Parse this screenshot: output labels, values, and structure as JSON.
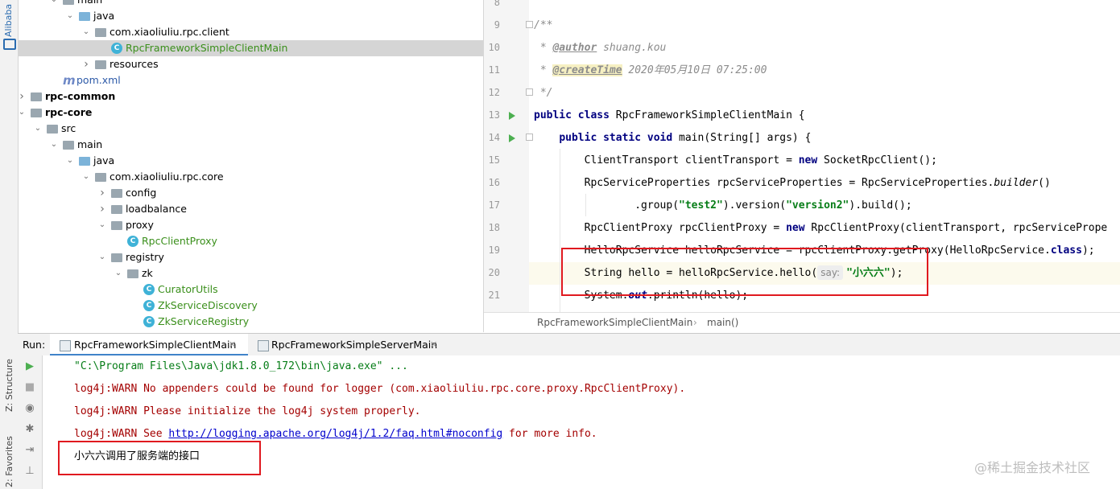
{
  "sidebar": {
    "alibaba_label": "Alibaba",
    "structure_label": "Z: Structure",
    "favorites_label": "2: Favorites"
  },
  "project_tree": {
    "items": [
      {
        "label": "main",
        "type": "folder",
        "expanded": true
      },
      {
        "label": "java",
        "type": "java-folder",
        "expanded": true
      },
      {
        "label": "com.xiaoliuliu.rpc.client",
        "type": "package",
        "expanded": true
      },
      {
        "label": "RpcFrameworkSimpleClientMain",
        "type": "class",
        "selected": true
      },
      {
        "label": "resources",
        "type": "resources-folder",
        "expanded": false
      },
      {
        "label": "pom.xml",
        "type": "maven"
      },
      {
        "label": "rpc-common",
        "type": "module",
        "expanded": false
      },
      {
        "label": "rpc-core",
        "type": "module",
        "expanded": true
      },
      {
        "label": "src",
        "type": "folder",
        "expanded": true
      },
      {
        "label": "main",
        "type": "folder",
        "expanded": true
      },
      {
        "label": "java",
        "type": "java-folder",
        "expanded": true
      },
      {
        "label": "com.xiaoliuliu.rpc.core",
        "type": "package",
        "expanded": true
      },
      {
        "label": "config",
        "type": "package",
        "expanded": false
      },
      {
        "label": "loadbalance",
        "type": "package",
        "expanded": false
      },
      {
        "label": "proxy",
        "type": "package",
        "expanded": true
      },
      {
        "label": "RpcClientProxy",
        "type": "class"
      },
      {
        "label": "registry",
        "type": "package",
        "expanded": true
      },
      {
        "label": "zk",
        "type": "package",
        "expanded": true
      },
      {
        "label": "CuratorUtils",
        "type": "class"
      },
      {
        "label": "ZkServiceDiscovery",
        "type": "class"
      },
      {
        "label": "ZkServiceRegistry",
        "type": "class"
      }
    ]
  },
  "editor": {
    "line_numbers": [
      "8",
      "9",
      "10",
      "11",
      "12",
      "13",
      "14",
      "15",
      "16",
      "17",
      "18",
      "19",
      "20",
      "21"
    ],
    "author_tag": "@author",
    "author_name": " shuang.kou",
    "createtime_tag": "@createTime",
    "createtime_value": " 2020年05月10日 07:25:00",
    "class_decl_name": "RpcFrameworkSimpleClientMain {",
    "main_sig": " main(String[] args) {",
    "line15_a": "ClientTransport clientTransport = ",
    "line15_b": " SocketRpcClient();",
    "line16_a": "RpcServiceProperties rpcServiceProperties = RpcServiceProperties.",
    "line16_builder": "builder",
    "line16_b": "()",
    "line17_a": ".group(",
    "line17_s1": "\"test2\"",
    "line17_b": ").version(",
    "line17_s2": "\"version2\"",
    "line17_c": ").build();",
    "line18_a": "RpcClientProxy rpcClientProxy = ",
    "line18_b": " RpcClientProxy(clientTransport, rpcServicePrope",
    "line19_a": "HelloRpcService helloRpcService = rpcClientProxy.getProxy(HelloRpcService.",
    "line19_kw": "class",
    "line19_b": ");",
    "line20_a": "String hello = helloRpcService.hello(",
    "line20_hint": "say:",
    "line20_str": "\"小六六\"",
    "line20_b": ");",
    "line21_a": "System.",
    "line21_out": "out",
    "line21_b": ".println(hello);",
    "breadcrumb": [
      "RpcFrameworkSimpleClientMain",
      "main()"
    ]
  },
  "run_panel": {
    "run_label": "Run:",
    "tabs": [
      {
        "label": "RpcFrameworkSimpleClientMain",
        "active": true
      },
      {
        "label": "RpcFrameworkSimpleServerMain",
        "active": false
      }
    ],
    "console": {
      "cmd": "\"C:\\Program Files\\Java\\jdk1.8.0_172\\bin\\java.exe\" ...",
      "warn1": "log4j:WARN No appenders could be found for logger (com.xiaoliuliu.rpc.core.proxy.RpcClientProxy).",
      "warn2": "log4j:WARN Please initialize the log4j system properly.",
      "warn3_prefix": "log4j:WARN See ",
      "warn3_link": "http://logging.apache.org/log4j/1.2/faq.html#noconfig",
      "warn3_suffix": " for more info.",
      "output": "小六六调用了服务端的接口"
    }
  },
  "watermark": "@稀土掘金技术社区",
  "colors": {
    "keyword": "#000080",
    "string": "#067d17",
    "warning": "#a40000",
    "highlight_box": "#e0191f",
    "selection": "#d5d5d5"
  }
}
